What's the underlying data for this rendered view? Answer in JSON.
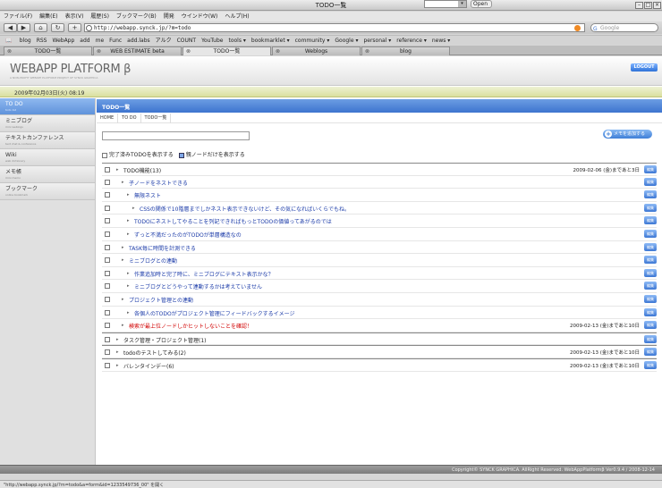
{
  "window": {
    "title": "TODO一覧",
    "open_label": "Open"
  },
  "menu": [
    "ファイル(F)",
    "編集(E)",
    "表示(V)",
    "履歴(S)",
    "ブックマーク(B)",
    "開発",
    "ウインドウ(W)",
    "ヘルプ(H)"
  ],
  "toolbar": {
    "url": "http://webapp.synck.jp/?m=todo",
    "search_placeholder": "Google",
    "icons": [
      "back-icon",
      "forward-icon",
      "home-icon",
      "reload-icon",
      "add-icon",
      "book-icon",
      "rss-icon"
    ]
  },
  "bookmarks": [
    "blog",
    "RSS",
    "WebApp",
    "add",
    "me",
    "Func",
    "add.labs",
    "アルク",
    "COUNT",
    "YouTube",
    "tools ▾",
    "bookmarklet ▾",
    "community ▾",
    "Google ▾",
    "personal ▾",
    "reference ▾",
    "news ▾"
  ],
  "tabs": [
    {
      "label": "TODO一覧",
      "active": false
    },
    {
      "label": "WEB ESTIMATE beta",
      "active": false
    },
    {
      "label": "TODO一覧",
      "active": true
    },
    {
      "label": "Weblogs",
      "active": false
    },
    {
      "label": "blog",
      "active": false
    }
  ],
  "header": {
    "logo": "WEBAPP PLATFORM β",
    "logo_sub": "A NON-PROFIT WEBAPP PLATFORM PROJECT OF SYNCK GRAPHICA",
    "logout": "LOGOUT",
    "datetime": "2009年02月03日(火) 08:19"
  },
  "sidebar": [
    {
      "label": "TO DO",
      "sub": "todo list",
      "active": true
    },
    {
      "label": "ミニブログ",
      "sub": "mini weblogs",
      "active": false
    },
    {
      "label": "テキストカンファレンス",
      "sub": "text chat & conference",
      "active": false
    },
    {
      "label": "Wiki",
      "sub": "web dictionary",
      "active": false
    },
    {
      "label": "メモ帳",
      "sub": "mini memo",
      "active": false
    },
    {
      "label": "ブックマーク",
      "sub": "online bookmark",
      "active": false
    }
  ],
  "main": {
    "title": "TODO一覧",
    "breadcrumb": [
      "HOME",
      "TO DO",
      "TODO一覧"
    ],
    "add_button": "メモを追加する",
    "options": [
      {
        "label": "完了済みTODOを表示する",
        "checked": false
      },
      {
        "label": "親ノードだけを表示する",
        "checked": true
      }
    ],
    "edit_label": "編集"
  },
  "todos": [
    {
      "label": "TODO機能(13)",
      "level": 0,
      "style": "black",
      "due": "2009-02-06 (金)まであと3日",
      "top": true
    },
    {
      "label": "子ノードをネストできる",
      "level": 1,
      "style": "link",
      "due": ""
    },
    {
      "label": "無限ネスト",
      "level": 2,
      "style": "link",
      "due": ""
    },
    {
      "label": "CSSの関係で10階層までしかネスト表示できないけど、その気になればいくらでもね。",
      "level": 3,
      "style": "link",
      "due": ""
    },
    {
      "label": "TODOにネストしてやることを列記できればもっとTODOの価値ってあがるのでは",
      "level": 2,
      "style": "link",
      "due": ""
    },
    {
      "label": "ずっと不満だったのがTODOが単層構造なの",
      "level": 2,
      "style": "link",
      "due": ""
    },
    {
      "label": "TASK毎に時間を計測できる",
      "level": 1,
      "style": "link",
      "due": ""
    },
    {
      "label": "ミニブログとの連動",
      "level": 1,
      "style": "link",
      "due": ""
    },
    {
      "label": "作業追加時と完了時に、ミニブログにテキスト表示かな？",
      "level": 2,
      "style": "link",
      "due": ""
    },
    {
      "label": "ミニブログとどうやって連動するかは考えていません",
      "level": 2,
      "style": "link",
      "due": ""
    },
    {
      "label": "プロジェクト管理との連動",
      "level": 1,
      "style": "link",
      "due": ""
    },
    {
      "label": "各個人のTODOがプロジェクト管理にフィードバックするイメージ",
      "level": 2,
      "style": "link",
      "due": ""
    },
    {
      "label": "検索が最上位ノードしかヒットしないことを確認！",
      "level": 1,
      "style": "red",
      "due": "2009-02-13 (金)まであと10日"
    },
    {
      "label": "タスク管理・プロジェクト管理(1)",
      "level": 0,
      "style": "black",
      "due": "",
      "top": true
    },
    {
      "label": "todoのテストしてみる(2)",
      "level": 0,
      "style": "black",
      "due": "2009-02-13 (金)まであと10日",
      "top": true
    },
    {
      "label": "バレンタインデー(6)",
      "level": 0,
      "style": "black",
      "due": "2009-02-13 (金)まであと10日",
      "top": true
    }
  ],
  "footer": "Copyright© SYNCK GRAPHICA. AllRight Reserved. WebAppPlatformβ Ver0.9.4 / 2008-12-14",
  "status": "\"http://webapp.synck.jp/?m=todo&a=form&id=1233549736_00\" を開く"
}
